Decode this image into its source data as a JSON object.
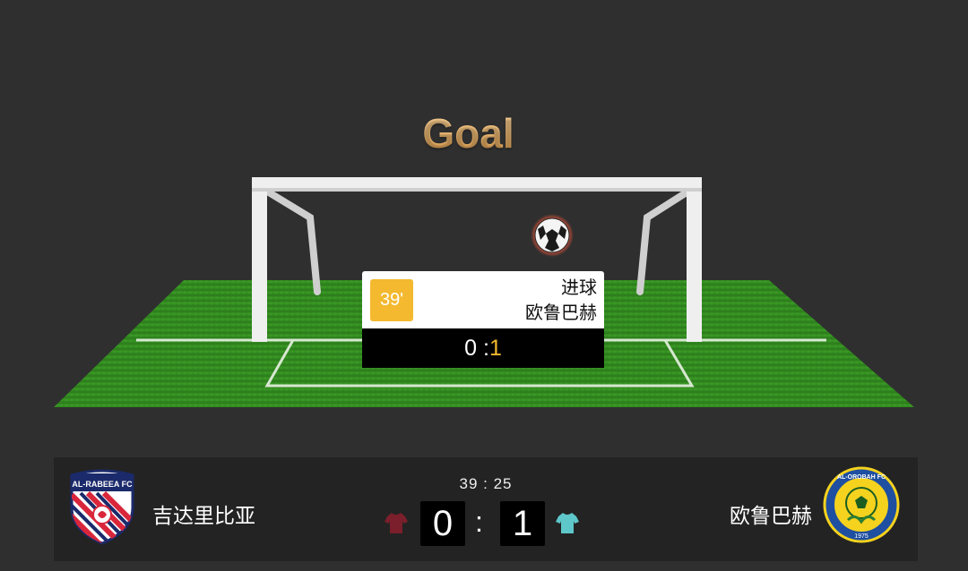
{
  "overlay": {
    "title": "Goal"
  },
  "event": {
    "minute": "39'",
    "type": "进球",
    "team": "欧鲁巴赫",
    "score_home": "0",
    "score_sep": " :",
    "score_away": "1"
  },
  "scoreboard": {
    "clock": "39 : 25",
    "home": {
      "name": "吉达里比亚",
      "crest_text": "AL-RABEEA FC",
      "score": "0",
      "jersey_color": "#7a1f2b"
    },
    "away": {
      "name": "欧鲁巴赫",
      "crest_text": "AL-OROBAH FC",
      "crest_year": "1975",
      "score": "1",
      "jersey_color": "#5ec7c9"
    },
    "separator": ":"
  },
  "colors": {
    "background": "#2f2f2f",
    "grass": "#2f8a1f",
    "accent": "#f4b92f",
    "title": "#f0b45c"
  }
}
